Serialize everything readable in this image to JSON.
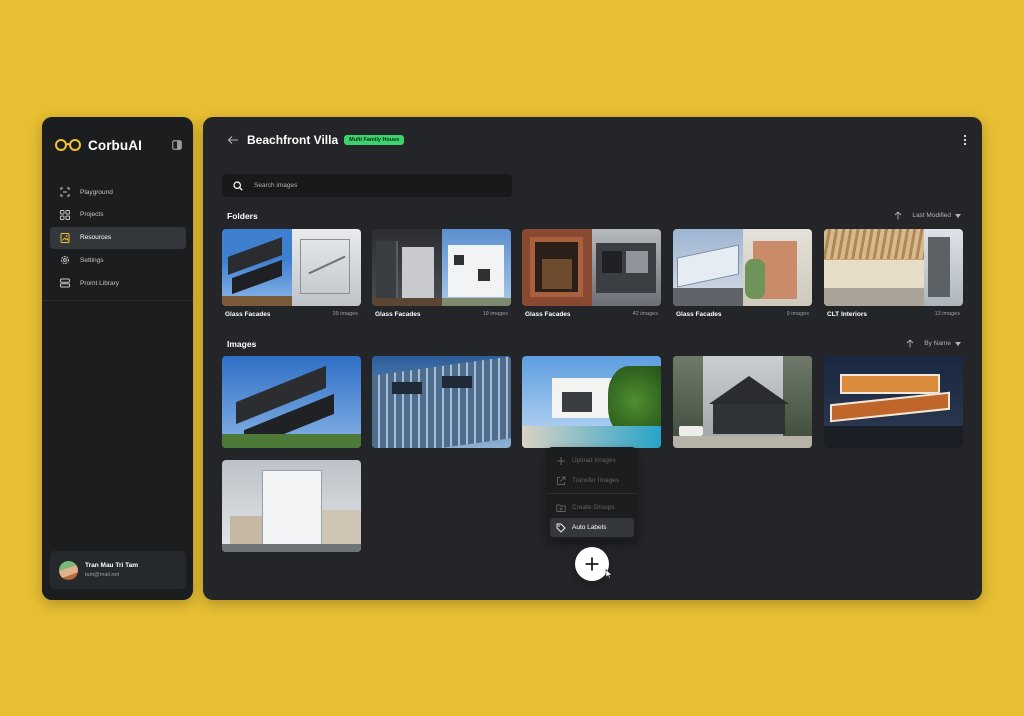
{
  "sidebar": {
    "brand": "CorbuAI",
    "nav": [
      {
        "label": "Playground",
        "icon": "scan-icon"
      },
      {
        "label": "Projects",
        "icon": "grid-icon"
      },
      {
        "label": "Resources",
        "icon": "image-file-icon",
        "active": true
      },
      {
        "label": "Settings",
        "icon": "gear-icon"
      },
      {
        "label": "Promt Library",
        "icon": "stack-icon"
      }
    ],
    "user": {
      "name": "Tran Mau Tri Tam",
      "email": "tam@mail.net"
    }
  },
  "header": {
    "title": "Beachfront Villa",
    "tag": "Multi Family House"
  },
  "search": {
    "placeholder": "Search images"
  },
  "folders_section": {
    "title": "Folders",
    "sort_label": "Last Modified",
    "items": [
      {
        "name": "Glass Facades",
        "count": "39 images"
      },
      {
        "name": "Glass Facades",
        "count": "19 images"
      },
      {
        "name": "Glass Facades",
        "count": "42 images"
      },
      {
        "name": "Glass Facades",
        "count": "9 images"
      },
      {
        "name": "CLT Interiors",
        "count": "13 images"
      }
    ]
  },
  "images_section": {
    "title": "Images",
    "sort_label": "By Name"
  },
  "menu": {
    "items": [
      {
        "label": "Upload Images",
        "enabled": false
      },
      {
        "label": "Transfer Images",
        "enabled": false
      },
      {
        "label": "Create Groups",
        "enabled": false
      },
      {
        "label": "Auto Labels",
        "enabled": true
      }
    ]
  },
  "colors": {
    "background": "#E8BF33",
    "panel": "#232528",
    "sidebar": "#1B1D1F",
    "tag": "#3BD36B",
    "brand_accent": "#F2C230"
  }
}
